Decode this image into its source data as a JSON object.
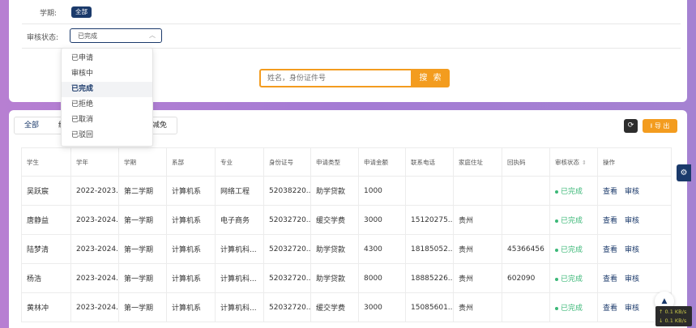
{
  "filters": {
    "semester_label": "学期:",
    "semester_tag": "全部",
    "status_label": "审核状态:",
    "status_value": "已完成",
    "status_options": [
      "已申请",
      "审核中",
      "已完成",
      "已拒绝",
      "已取消",
      "已驳回"
    ],
    "status_selected_index": 2
  },
  "search": {
    "placeholder": "姓名，身份证件号",
    "button_label": "搜 索"
  },
  "tabs": [
    "全部",
    "缓",
    "",
    "费减免"
  ],
  "toolbar": {
    "refresh_icon": "refresh-icon",
    "export_label": "导 出"
  },
  "table": {
    "columns": [
      "学生",
      "学年",
      "学期",
      "系部",
      "专业",
      "身份证号",
      "申请类型",
      "申请金额",
      "联系电话",
      "家庭住址",
      "回执码",
      "审核状态",
      "操作"
    ],
    "rows": [
      [
        "吴跃宸",
        "2022-2023...",
        "第二学期",
        "计算机系",
        "网络工程",
        "52038220...",
        "助学贷款",
        "1000",
        "",
        "",
        "",
        "已完成"
      ],
      [
        "唐静益",
        "2023-2024...",
        "第一学期",
        "计算机系",
        "电子商务",
        "52032720...",
        "缓交学费",
        "3000",
        "15120275...",
        "贵州",
        "",
        "已完成"
      ],
      [
        "陆梦清",
        "2023-2024...",
        "第一学期",
        "计算机系",
        "计算机科...",
        "52032720...",
        "助学贷款",
        "4300",
        "18185052...",
        "贵州",
        "45366456",
        "已完成"
      ],
      [
        "杨浩",
        "2023-2024...",
        "第一学期",
        "计算机系",
        "计算机科...",
        "52032720...",
        "助学贷款",
        "8000",
        "18885226...",
        "贵州",
        "602090",
        "已完成"
      ],
      [
        "黄林冲",
        "2023-2024...",
        "第一学期",
        "计算机系",
        "计算机科...",
        "52032720...",
        "缓交学费",
        "3000",
        "15085601...",
        "贵州",
        "",
        "已完成"
      ]
    ],
    "actions": [
      "查看",
      "审核"
    ]
  },
  "network_speed": {
    "up": "↑ 0.1 KB/s",
    "down": "↓ 0.1 KB/s"
  },
  "colors": {
    "primary": "#1b3a6b",
    "accent": "#f39c1f",
    "success": "#3cb878"
  }
}
